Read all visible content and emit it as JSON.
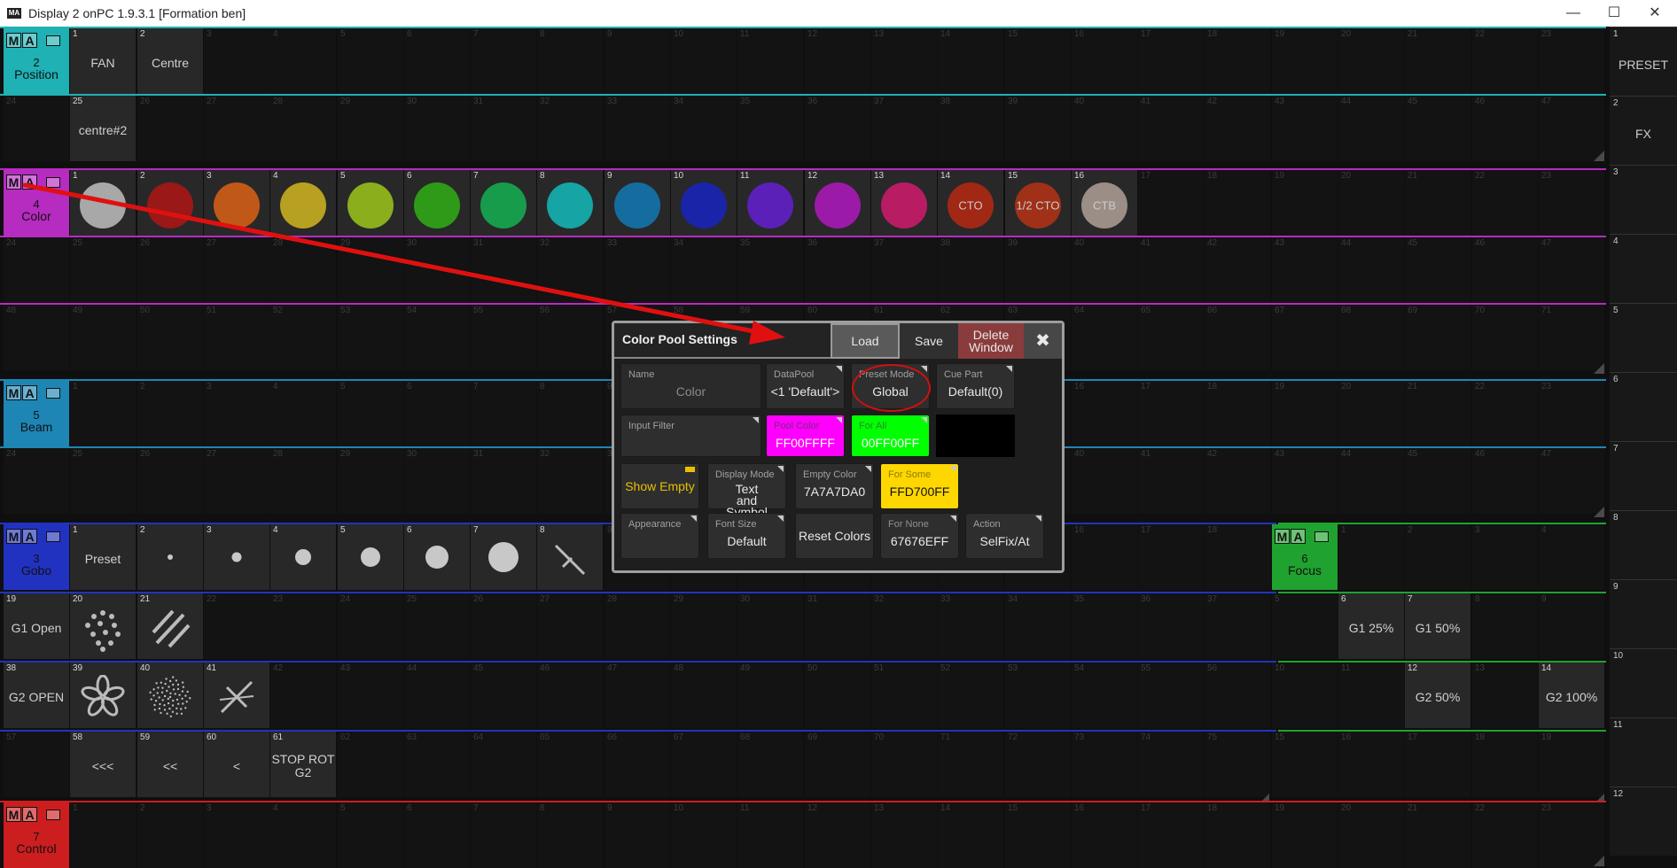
{
  "app": {
    "title": "Display 2 onPC 1.9.3.1 [Formation ben]",
    "logo": "MA",
    "min": "—",
    "max": "☐",
    "close": "✕"
  },
  "ma_text": [
    "M",
    "A"
  ],
  "windows": {
    "position": {
      "num": "2",
      "name": "Position",
      "color": "#1fb1b4"
    },
    "color": {
      "num": "4",
      "name": "Color",
      "color": "#b62bc0"
    },
    "beam": {
      "num": "5",
      "name": "Beam",
      "color": "#1d86b5"
    },
    "gobo": {
      "num": "3",
      "name": "Gobo",
      "color": "#2232c0"
    },
    "focus": {
      "num": "6",
      "name": "Focus",
      "color": "#1fa22f"
    },
    "control": {
      "num": "7",
      "name": "Control",
      "color": "#cc1e1e"
    }
  },
  "position_presets": [
    {
      "n": "1",
      "label": "FAN"
    },
    {
      "n": "2",
      "label": "Centre"
    },
    {
      "n": "25",
      "label": "centre#2"
    }
  ],
  "color_presets": [
    {
      "n": "1",
      "color": "#a8a8a8"
    },
    {
      "n": "2",
      "color": "#9a1818"
    },
    {
      "n": "3",
      "color": "#c05818"
    },
    {
      "n": "4",
      "color": "#b8a020"
    },
    {
      "n": "5",
      "color": "#8aae1c"
    },
    {
      "n": "6",
      "color": "#2e9a18"
    },
    {
      "n": "7",
      "color": "#179c4c"
    },
    {
      "n": "8",
      "color": "#16a4a4"
    },
    {
      "n": "9",
      "color": "#156c9e"
    },
    {
      "n": "10",
      "color": "#1a24a8"
    },
    {
      "n": "11",
      "color": "#5a20b8"
    },
    {
      "n": "12",
      "color": "#9c1aa8"
    },
    {
      "n": "13",
      "color": "#b81c62"
    },
    {
      "n": "14",
      "color": "#a02814",
      "label": "CTO"
    },
    {
      "n": "15",
      "color": "#a03018",
      "label": "1/2 CTO"
    },
    {
      "n": "16",
      "color": "#9a8e86",
      "label": "CTB"
    }
  ],
  "gobo_presets": [
    {
      "n": "1",
      "label": "Preset"
    },
    {
      "n": "2"
    },
    {
      "n": "3"
    },
    {
      "n": "4"
    },
    {
      "n": "5"
    },
    {
      "n": "6"
    },
    {
      "n": "7"
    },
    {
      "n": "8"
    },
    {
      "n": "19",
      "label": "G1 Open"
    },
    {
      "n": "20"
    },
    {
      "n": "21"
    },
    {
      "n": "38",
      "label": "G2 OPEN"
    },
    {
      "n": "39"
    },
    {
      "n": "40"
    },
    {
      "n": "41"
    },
    {
      "n": "58",
      "label": "<<<"
    },
    {
      "n": "59",
      "label": "<<"
    },
    {
      "n": "60",
      "label": "<"
    },
    {
      "n": "61",
      "label": "STOP ROT G2"
    }
  ],
  "focus_presets": [
    {
      "n": "6",
      "label": "G1 25%"
    },
    {
      "n": "7",
      "label": "G1 50%"
    },
    {
      "n": "12",
      "label": "G2 50%"
    },
    {
      "n": "14",
      "label": "G2 100%"
    }
  ],
  "right_tabs": [
    {
      "n": "1",
      "label": "PRESET"
    },
    {
      "n": "2",
      "label": "FX"
    },
    {
      "n": "3"
    },
    {
      "n": "4"
    },
    {
      "n": "5"
    },
    {
      "n": "6"
    },
    {
      "n": "7"
    },
    {
      "n": "8"
    },
    {
      "n": "9"
    },
    {
      "n": "10"
    },
    {
      "n": "11"
    },
    {
      "n": "12"
    }
  ],
  "dialog": {
    "title": "Color Pool Settings",
    "load": "Load",
    "save": "Save",
    "delete": "Delete Window",
    "close": "✖",
    "name_label": "Name",
    "name_value": "Color",
    "datapool_label": "DataPool",
    "datapool_value": "<1 'Default'>",
    "preset_mode_label": "Preset Mode",
    "preset_mode_value": "Global",
    "cue_part_label": "Cue Part",
    "cue_part_value": "Default(0)",
    "input_filter_label": "Input Filter",
    "pool_color_label": "Pool Color",
    "pool_color_value": "FF00FFFF",
    "pool_color_hex": "#ff00ff",
    "ok_label": "For All",
    "ok_value": "00FF00FF",
    "ok_hex": "#00ff00",
    "show_empty": "Show Empty",
    "display_mode_label": "Display Mode",
    "display_mode_value": "Text and Symbol",
    "empty_color_label": "Empty Color",
    "empty_color_value": "7A7A7DA0",
    "for_some_label": "For Some",
    "for_some_value": "FFD700FF",
    "for_some_hex": "#ffd700",
    "appearance_label": "Appearance",
    "font_size_label": "Font Size",
    "font_size_value": "Default",
    "reset_colors": "Reset Colors",
    "for_none_label": "For None",
    "for_none_value": "67676EFF",
    "action_label": "Action",
    "action_value": "SelFix/At"
  }
}
